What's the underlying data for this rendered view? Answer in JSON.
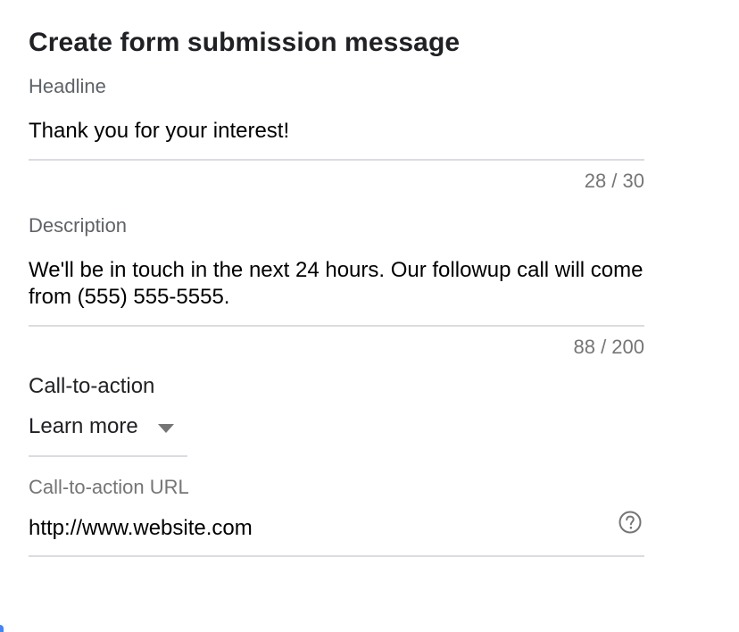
{
  "form": {
    "title": "Create form submission message",
    "headline": {
      "label": "Headline",
      "value": "Thank you for your interest!",
      "counter": "28 / 30"
    },
    "description": {
      "label": "Description",
      "value": "We'll be in touch in the next 24 hours. Our followup call will come from (555) 555-5555.",
      "counter": "88 / 200"
    },
    "call_to_action": {
      "label": "Call-to-action",
      "selected": "Learn more"
    },
    "cta_url": {
      "label": "Call-to-action URL",
      "value": "http://www.website.com"
    }
  },
  "icons": {
    "help": "help-circle-icon",
    "dropdown": "arrow-drop-down-icon"
  },
  "colors": {
    "text_primary": "#202124",
    "text_secondary": "#5f6368",
    "counter_text": "#757575",
    "divider": "#dadce0",
    "accent": "#4285f4"
  }
}
